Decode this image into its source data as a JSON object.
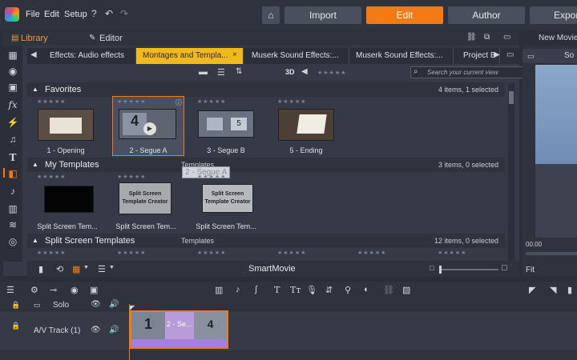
{
  "menu": {
    "file": "File",
    "edit": "Edit",
    "setup": "Setup"
  },
  "modes": {
    "import": "Import",
    "edit": "Edit",
    "author": "Author",
    "export": "Export"
  },
  "panel_tabs": {
    "library": "Library",
    "editor": "Editor",
    "preview": "New Movie"
  },
  "library_tabs": [
    "Effects: Audio effects",
    "Montages and Templa...",
    "Muserk Sound Effects:...",
    "Muserk Sound Effects:...",
    "Project B"
  ],
  "toolbar": {
    "mode_3d": "3D",
    "search_placeholder": "Search your current view"
  },
  "sections": {
    "favorites": {
      "title": "Favorites",
      "count": "4 items, 1 selected"
    },
    "my_templates": {
      "title": "My Templates",
      "subtitle": "Templates",
      "count": "3 items, 0 selected"
    },
    "split_screen": {
      "title": "Split Screen Templates",
      "subtitle": "Templates",
      "count": "12 items, 0 selected"
    }
  },
  "favorites_items": [
    "1 - Opening",
    "2 - Segue A",
    "3 - Segue B",
    "5 - Ending"
  ],
  "template_items": [
    "Split Screen Tem...",
    "Split Screen Tem...",
    "Split Screen Tem..."
  ],
  "thumb_text": {
    "split_line1": "Split Screen",
    "split_line2": "Template Creator",
    "num_4": "4",
    "num_5": "5"
  },
  "drag_tooltip": "2 - Segue A",
  "footer": {
    "title": "SmartMovie"
  },
  "preview": {
    "timecode": "00.00",
    "fit": "Fit",
    "tab_partial": "So"
  },
  "timeline": {
    "tracks": [
      {
        "name": "Solo"
      },
      {
        "name": "A/V Track (1)"
      }
    ],
    "clip": {
      "label": "2 - Se...",
      "left_num": "1",
      "right_num": "4"
    }
  },
  "colors": {
    "accent": "#f47b14",
    "active_tab": "#f2b91d",
    "bg": "#2b2f3a"
  }
}
